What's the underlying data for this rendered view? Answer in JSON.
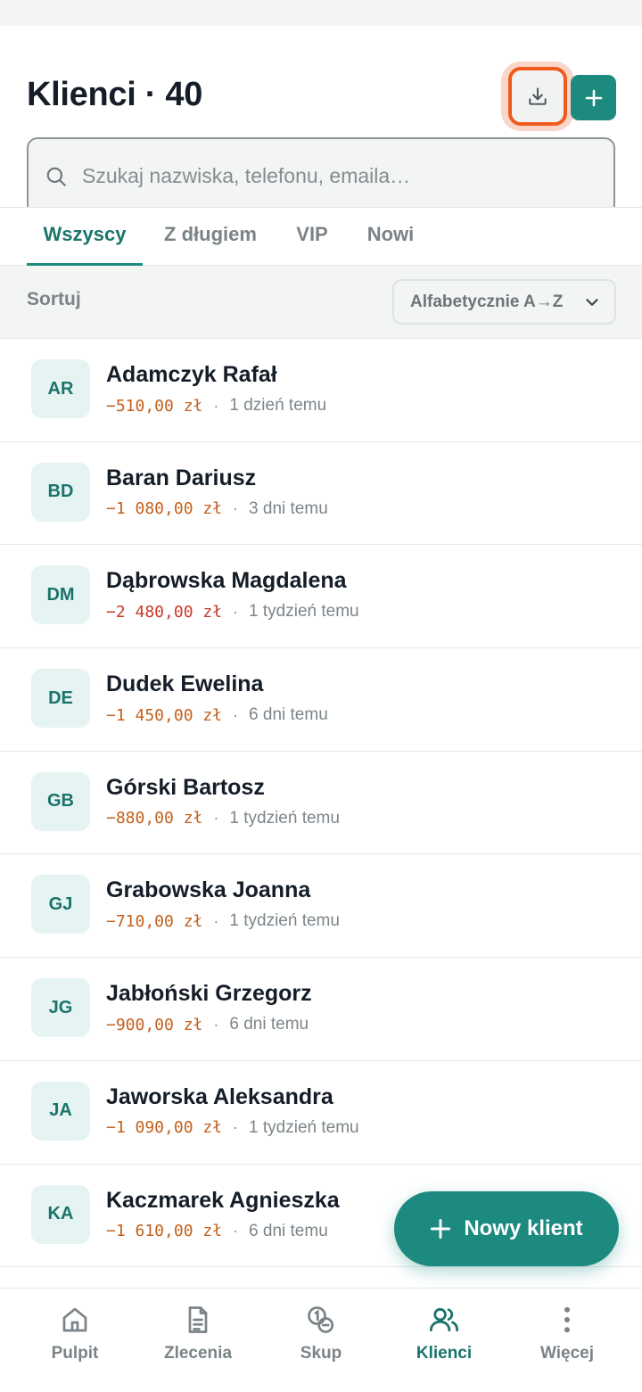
{
  "header": {
    "title": "Klienci · 40",
    "export_icon": "download-icon",
    "add_icon": "plus-icon"
  },
  "search": {
    "placeholder": "Szukaj nazwiska, telefonu, emaila…",
    "icon": "search-icon"
  },
  "tabs": [
    {
      "label": "Wszyscy",
      "active": true
    },
    {
      "label": "Z długiem",
      "active": false
    },
    {
      "label": "VIP",
      "active": false
    },
    {
      "label": "Nowi",
      "active": false
    }
  ],
  "sort": {
    "label": "Sortuj",
    "value": "Alfabetycznie A→Z"
  },
  "clients": [
    {
      "initials": "AR",
      "name": "Adamczyk Rafał",
      "amount": "−510,00 zł",
      "ago": "1 dzień temu"
    },
    {
      "initials": "BD",
      "name": "Baran Dariusz",
      "amount": "−1 080,00 zł",
      "ago": "3 dni temu"
    },
    {
      "initials": "DM",
      "name": "Dąbrowska Magdalena",
      "amount": "−2 480,00 zł",
      "ago": "1 tydzień temu"
    },
    {
      "initials": "DE",
      "name": "Dudek Ewelina",
      "amount": "−1 450,00 zł",
      "ago": "6 dni temu"
    },
    {
      "initials": "GB",
      "name": "Górski Bartosz",
      "amount": "−880,00 zł",
      "ago": "1 tydzień temu"
    },
    {
      "initials": "GJ",
      "name": "Grabowska Joanna",
      "amount": "−710,00 zł",
      "ago": "1 tydzień temu"
    },
    {
      "initials": "JG",
      "name": "Jabłoński Grzegorz",
      "amount": "−900,00 zł",
      "ago": "6 dni temu"
    },
    {
      "initials": "JA",
      "name": "Jaworska Aleksandra",
      "amount": "−1 090,00 zł",
      "ago": "1 tydzień temu"
    },
    {
      "initials": "KA",
      "name": "Kaczmarek Agnieszka",
      "amount": "−1 610,00 zł",
      "ago": "6 dni temu"
    }
  ],
  "separator": "·",
  "fab": {
    "label": "Nowy klient",
    "icon": "plus-icon"
  },
  "bottom_nav": [
    {
      "label": "Pulpit",
      "icon": "home-icon",
      "active": false
    },
    {
      "label": "Zlecenia",
      "icon": "document-icon",
      "active": false
    },
    {
      "label": "Skup",
      "icon": "coins-icon",
      "active": false
    },
    {
      "label": "Klienci",
      "icon": "users-icon",
      "active": true
    },
    {
      "label": "Więcej",
      "icon": "more-vertical-icon",
      "active": false
    }
  ],
  "colors": {
    "accent": "#1d8a80",
    "highlight": "#f05a1e",
    "debt": "#c4601c",
    "debt_high": "#c63a2a"
  }
}
